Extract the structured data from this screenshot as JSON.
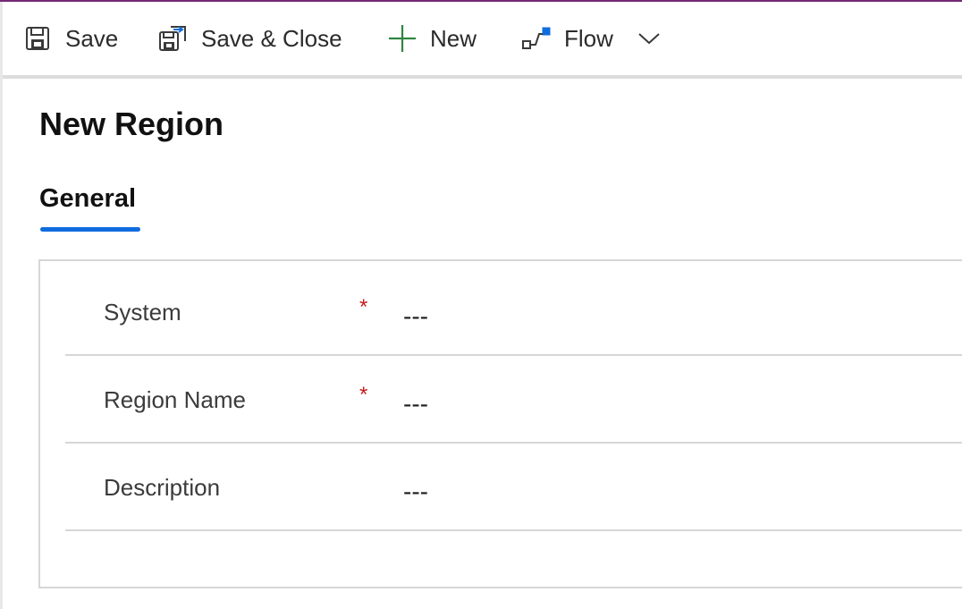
{
  "toolbar": {
    "save_label": "Save",
    "save_close_label": "Save & Close",
    "new_label": "New",
    "flow_label": "Flow",
    "icons": {
      "save": "save-icon",
      "save_close": "save-close-icon",
      "new": "plus-icon",
      "flow": "flow-icon",
      "more": "chevron-down-icon"
    }
  },
  "form": {
    "title": "New Region",
    "tabs": [
      {
        "label": "General",
        "selected": true
      }
    ],
    "fields": [
      {
        "label": "System",
        "required": true,
        "required_marker": "*",
        "value": "---"
      },
      {
        "label": "Region Name",
        "required": true,
        "required_marker": "*",
        "value": "---"
      },
      {
        "label": "Description",
        "required": false,
        "required_marker": "",
        "value": "---"
      }
    ]
  },
  "colors": {
    "top_accent": "#742774",
    "tab_underline": "#0f6cde",
    "required_marker": "#c21d1d",
    "new_icon": "#2e8540",
    "flow_icon": "#0f6cde"
  }
}
